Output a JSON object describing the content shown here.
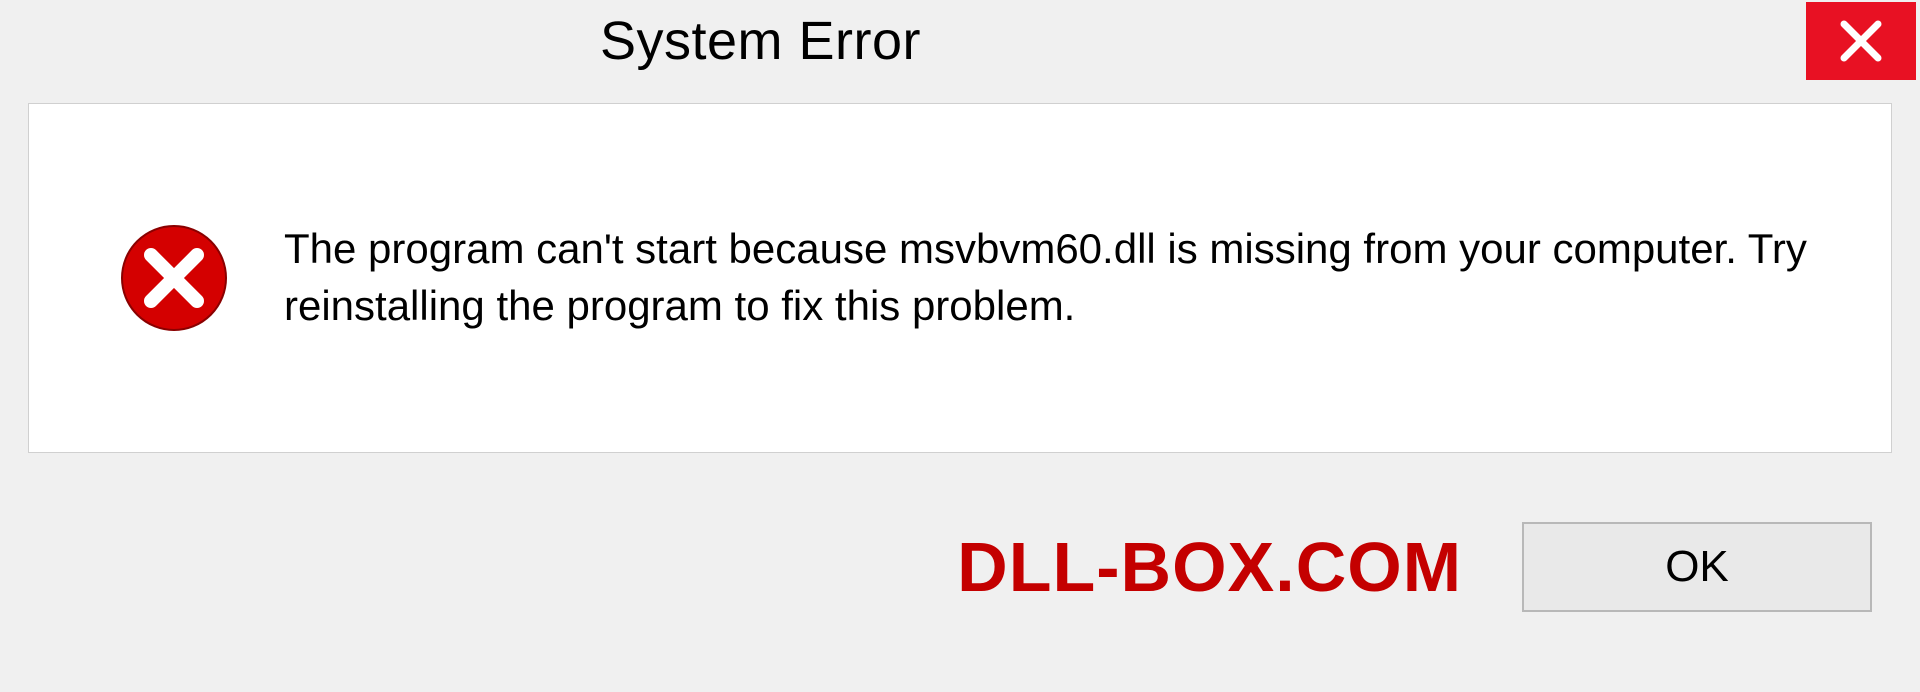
{
  "dialog": {
    "title": "System Error",
    "message": "The program can't start because msvbvm60.dll is missing from your computer. Try reinstalling the program to fix this problem.",
    "ok_label": "OK"
  },
  "watermark": "DLL-BOX.COM",
  "colors": {
    "close_bg": "#e81123",
    "error_icon": "#d40000",
    "watermark": "#c40000"
  }
}
